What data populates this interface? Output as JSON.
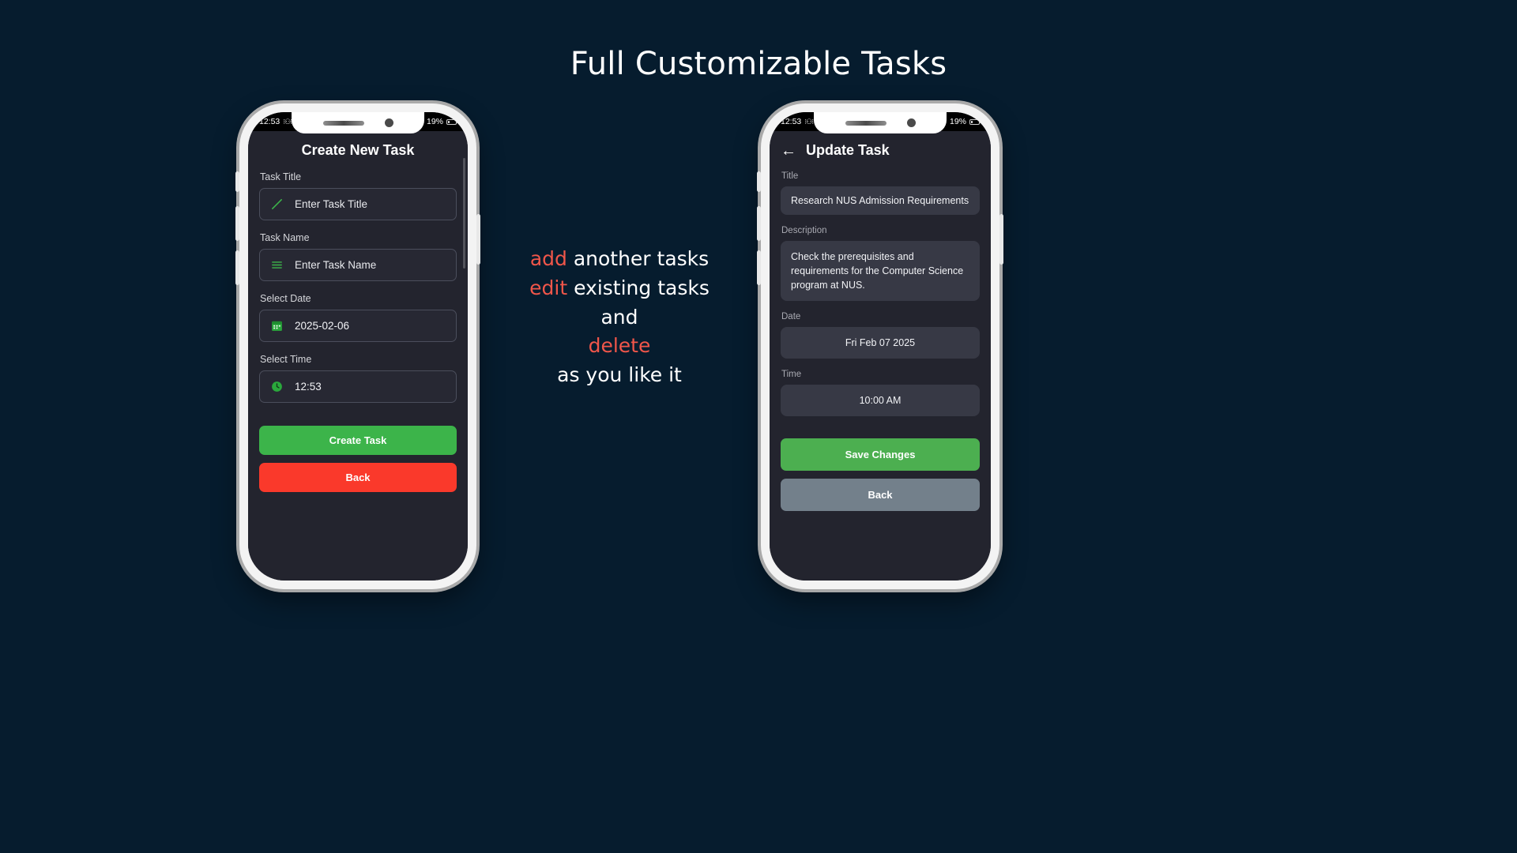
{
  "headline": "Full Customizable Tasks",
  "colors": {
    "background": "#061c2e",
    "accent_green": "#3cb44a",
    "accent_red": "#fa392b",
    "highlight": "#f0564a",
    "grey_button": "#707a85",
    "screen_bg": "#23242e"
  },
  "status_bar": {
    "time": "12:53",
    "battery": "19%",
    "dots_glyph": "⁝⚇⁝",
    "signal_icon": "signal-bars-icon",
    "battery_icon": "battery-icon"
  },
  "left_phone": {
    "title": "Create New Task",
    "fields": [
      {
        "label": "Task Title",
        "placeholder": "Enter Task Title",
        "value": "",
        "icon": "pencil-icon",
        "icon_color": "#3cb44a"
      },
      {
        "label": "Task Name",
        "placeholder": "Enter Task Name",
        "value": "",
        "icon": "list-lines-icon",
        "icon_color": "#3cb44a"
      },
      {
        "label": "Select Date",
        "placeholder": "",
        "value": "2025-02-06",
        "icon": "calendar-icon",
        "icon_color": "#3cb44a"
      },
      {
        "label": "Select Time",
        "placeholder": "",
        "value": "12:53",
        "icon": "clock-icon",
        "icon_color": "#3cb44a"
      }
    ],
    "primary_button": "Create Task",
    "secondary_button": "Back"
  },
  "right_phone": {
    "back_icon": "arrow-left-icon",
    "title": "Update Task",
    "fields": [
      {
        "label": "Title",
        "value": "Research NUS Admission Requirements"
      },
      {
        "label": "Description",
        "value": "Check the prerequisites and requirements for the Computer Science program at NUS."
      },
      {
        "label": "Date",
        "value": "Fri Feb 07 2025"
      },
      {
        "label": "Time",
        "value": "10:00 AM"
      }
    ],
    "primary_button": "Save Changes",
    "secondary_button": "Back"
  },
  "center_copy": {
    "line1_highlight": "add",
    "line1_rest": " another tasks",
    "line2_highlight": "edit",
    "line2_rest": " existing tasks",
    "line3": "and",
    "line4_highlight": "delete",
    "line5": "as you like it"
  }
}
